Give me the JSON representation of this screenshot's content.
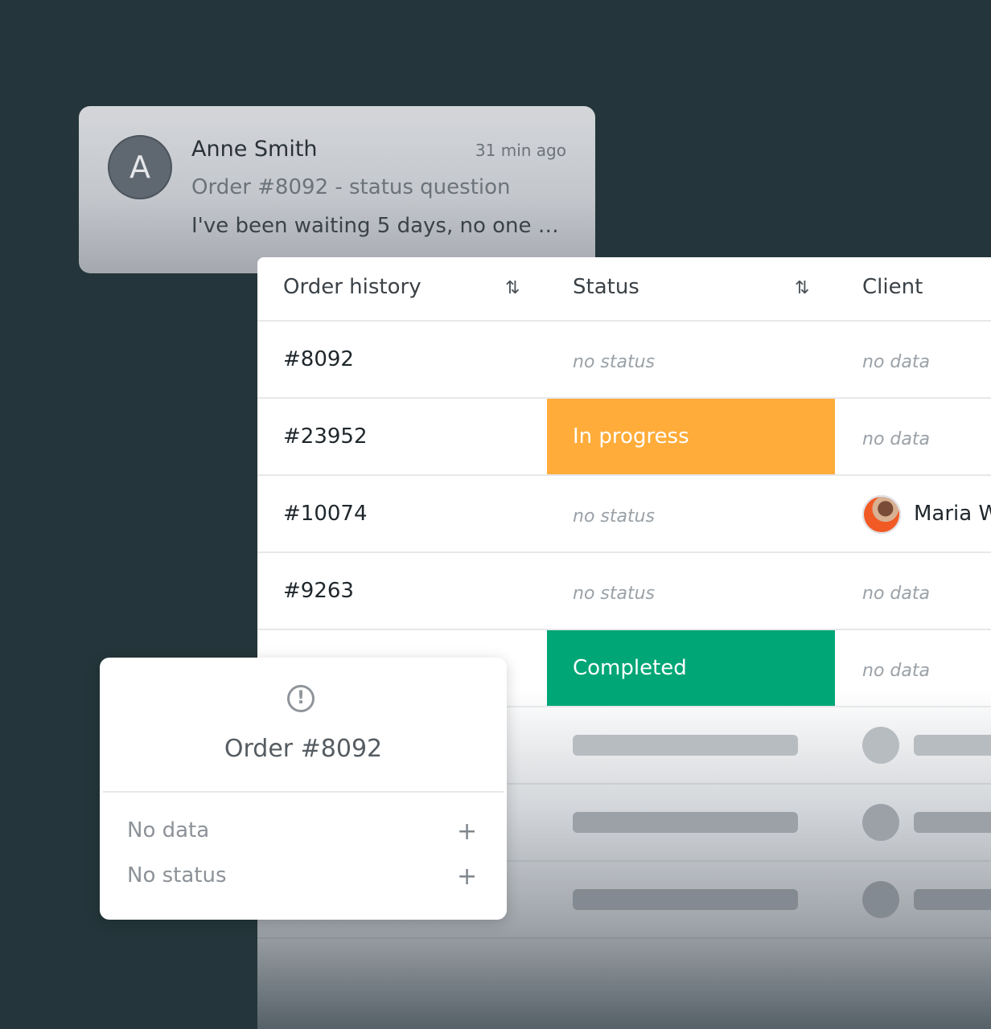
{
  "notification": {
    "avatar_initial": "A",
    "name": "Anne Smith",
    "time": "31 min ago",
    "subject": "Order #8092 - status question",
    "preview": "I've been waiting 5 days, no one is..."
  },
  "table": {
    "columns": {
      "order_history": "Order history",
      "status": "Status",
      "client": "Client",
      "sort_icon": "⇅"
    },
    "rows": [
      {
        "id": "#8092",
        "status": "no status",
        "client": "no data"
      },
      {
        "id": "#23952",
        "status": "In progress",
        "client": "no data"
      },
      {
        "id": "#10074",
        "status": "no status",
        "client": "Maria W"
      },
      {
        "id": "#9263",
        "status": "no status",
        "client": "no data"
      },
      {
        "id": "",
        "status": "Completed",
        "client": "no data"
      }
    ],
    "status_colors": {
      "in_progress": "#ffac3a",
      "completed": "#00a676"
    }
  },
  "order_card": {
    "icon": "alert-circle-icon",
    "title": "Order #8092",
    "options": [
      {
        "label": "No data",
        "action": "+"
      },
      {
        "label": "No status",
        "action": "+"
      }
    ]
  }
}
